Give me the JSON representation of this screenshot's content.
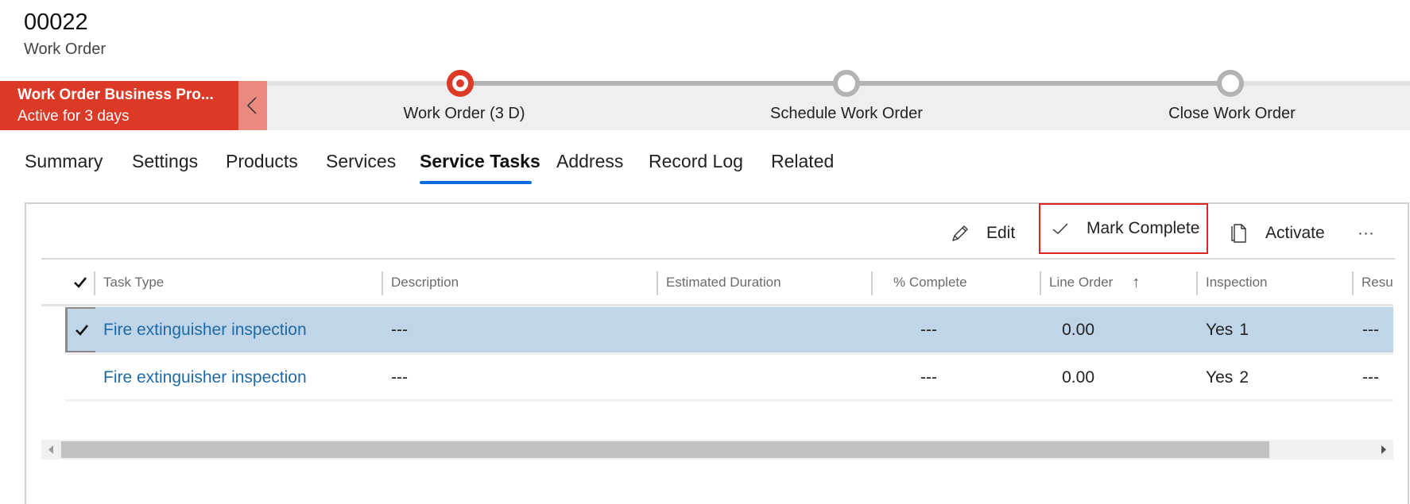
{
  "record": {
    "id": "00022",
    "entity": "Work Order"
  },
  "bpf": {
    "name": "Work Order Business Pro...",
    "status": "Active for 3 days",
    "colors": {
      "active": "#dc3a26",
      "collapse": "#ea8a7e",
      "inactive": "#b3b3b3"
    },
    "stages": [
      {
        "label": "Work Order  (3 D)",
        "state": "active"
      },
      {
        "label": "Schedule Work Order",
        "state": "inactive"
      },
      {
        "label": "Close Work Order",
        "state": "inactive"
      }
    ]
  },
  "tabs": [
    {
      "label": "Summary"
    },
    {
      "label": "Settings"
    },
    {
      "label": "Products"
    },
    {
      "label": "Services"
    },
    {
      "label": "Service Tasks",
      "active": true
    },
    {
      "label": "Address"
    },
    {
      "label": "Record Log"
    },
    {
      "label": "Related"
    }
  ],
  "toolbar": {
    "edit": "Edit",
    "mark_complete": "Mark Complete",
    "activate": "Activate",
    "more": "···"
  },
  "grid": {
    "columns": [
      "Task Type",
      "Description",
      "Estimated Duration",
      "% Complete",
      "Line Order",
      "Inspection",
      "Resul"
    ],
    "sort": {
      "column": "Line Order",
      "direction": "ascending",
      "icon": "↑"
    },
    "rows": [
      {
        "selected": true,
        "task_type": "Fire extinguisher inspection",
        "description": "---",
        "estimated_duration": "---",
        "percent_complete": "0.00",
        "line_order": "1",
        "inspection": "Yes",
        "result": "---"
      },
      {
        "selected": false,
        "task_type": "Fire extinguisher inspection",
        "description": "---",
        "estimated_duration": "---",
        "percent_complete": "0.00",
        "line_order": "2",
        "inspection": "Yes",
        "result": "---"
      }
    ],
    "horizontal_scroll": {
      "visible_fraction": 0.9,
      "position": 0
    }
  }
}
